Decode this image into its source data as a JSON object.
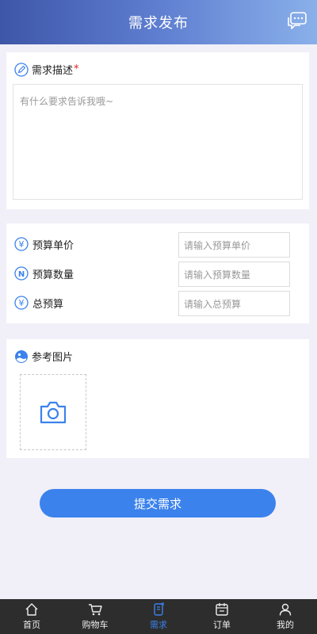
{
  "header": {
    "title": "需求发布",
    "message_icon": "chat-bubble-icon"
  },
  "description": {
    "title": "需求描述",
    "required_mark": "*",
    "placeholder": "有什么要求告诉我哦~"
  },
  "budget": {
    "rows": [
      {
        "label": "预算单价",
        "icon": "yen-circle-icon",
        "placeholder": "请输入预算单价"
      },
      {
        "label": "预算数量",
        "icon": "n-circle-icon",
        "placeholder": "请输入预算数量"
      },
      {
        "label": "总预算",
        "icon": "yen-circle-icon",
        "placeholder": "请输入总预算"
      }
    ]
  },
  "photos": {
    "title": "参考图片",
    "add_icon": "camera-icon"
  },
  "submit": {
    "label": "提交需求"
  },
  "tabbar": {
    "items": [
      {
        "label": "首页",
        "icon": "home-icon"
      },
      {
        "label": "购物车",
        "icon": "cart-icon"
      },
      {
        "label": "需求",
        "icon": "demand-icon",
        "active": true
      },
      {
        "label": "订单",
        "icon": "order-icon"
      },
      {
        "label": "我的",
        "icon": "user-icon"
      }
    ]
  },
  "colors": {
    "accent": "#3b82ec",
    "tabbar_bg": "#2d2d2d",
    "required": "#e02020"
  }
}
